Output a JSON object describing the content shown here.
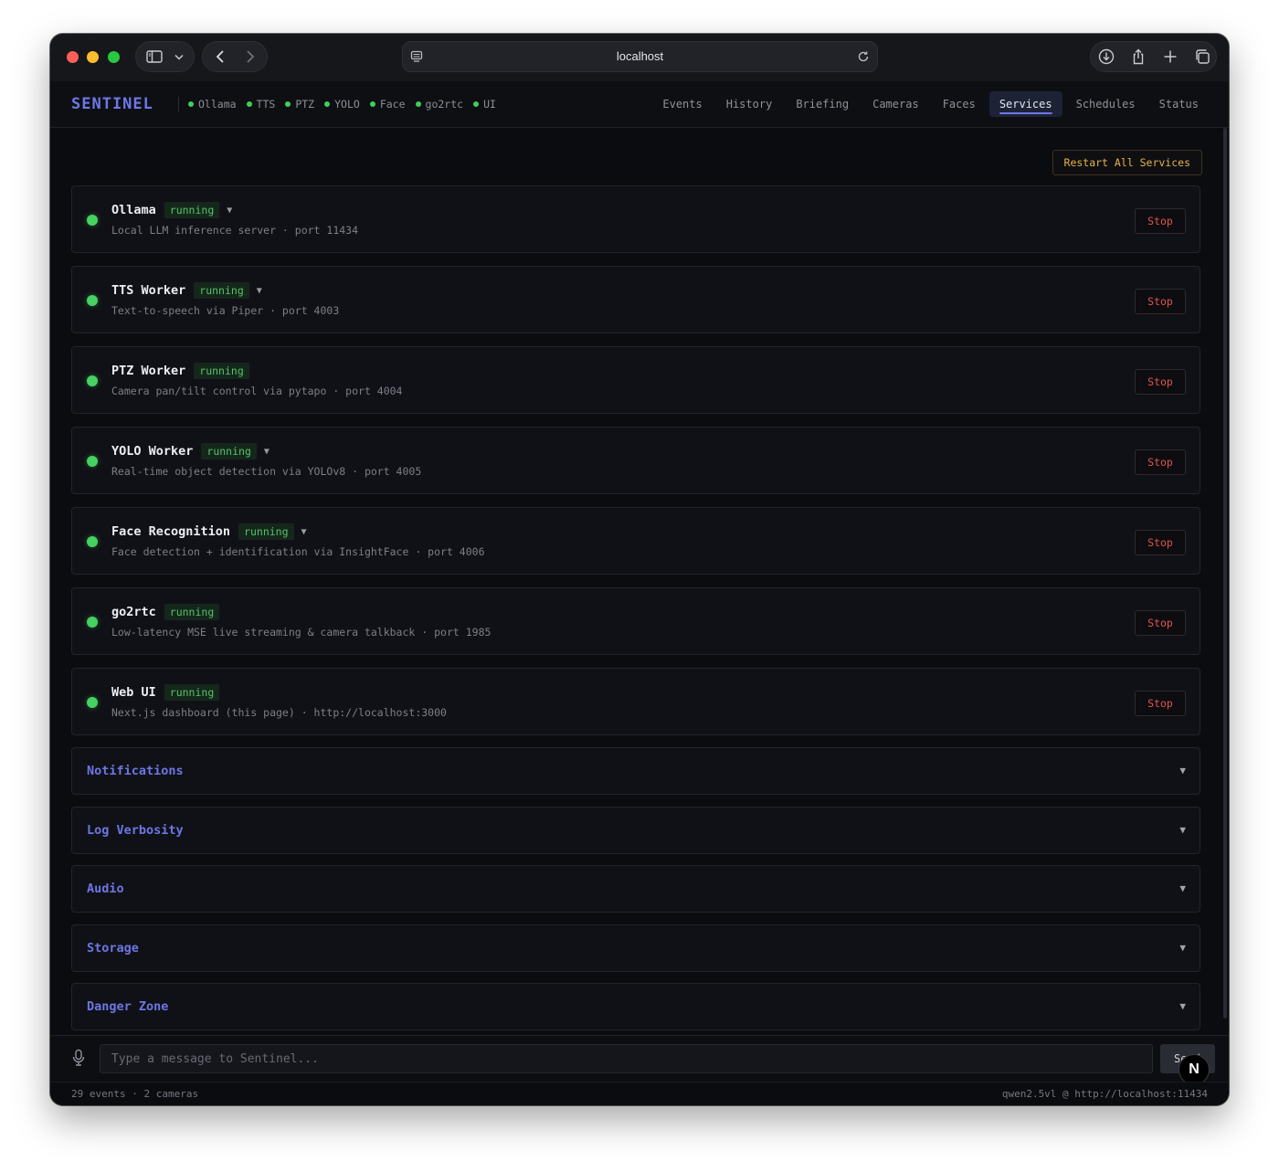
{
  "browser": {
    "url": "localhost"
  },
  "app": {
    "brand": "SENTINEL",
    "service_status": [
      {
        "label": "Ollama",
        "status_color": "#3fcf5a"
      },
      {
        "label": "TTS",
        "status_color": "#3fcf5a"
      },
      {
        "label": "PTZ",
        "status_color": "#3fcf5a"
      },
      {
        "label": "YOLO",
        "status_color": "#3fcf5a"
      },
      {
        "label": "Face",
        "status_color": "#3fcf5a"
      },
      {
        "label": "go2rtc",
        "status_color": "#3fcf5a"
      },
      {
        "label": "UI",
        "status_color": "#3fcf5a"
      }
    ],
    "tabs": [
      "Events",
      "History",
      "Briefing",
      "Cameras",
      "Faces",
      "Services",
      "Schedules",
      "Status"
    ],
    "active_tab": "Services"
  },
  "main": {
    "restart_all_label": "Restart All Services",
    "services": [
      {
        "name": "Ollama",
        "status": "running",
        "expandable": true,
        "description": "Local LLM inference server · port 11434",
        "action": "Stop"
      },
      {
        "name": "TTS Worker",
        "status": "running",
        "expandable": true,
        "description": "Text-to-speech via Piper · port 4003",
        "action": "Stop"
      },
      {
        "name": "PTZ Worker",
        "status": "running",
        "expandable": false,
        "description": "Camera pan/tilt control via pytapo · port 4004",
        "action": "Stop"
      },
      {
        "name": "YOLO Worker",
        "status": "running",
        "expandable": true,
        "description": "Real-time object detection via YOLOv8 · port 4005",
        "action": "Stop"
      },
      {
        "name": "Face Recognition",
        "status": "running",
        "expandable": true,
        "description": "Face detection + identification via InsightFace · port 4006",
        "action": "Stop"
      },
      {
        "name": "go2rtc",
        "status": "running",
        "expandable": false,
        "description": "Low-latency MSE live streaming & camera talkback · port 1985",
        "action": "Stop"
      },
      {
        "name": "Web UI",
        "status": "running",
        "expandable": false,
        "description": "Next.js dashboard (this page) · http://localhost:3000",
        "action": "Stop"
      }
    ],
    "sections": [
      "Notifications",
      "Log Verbosity",
      "Audio",
      "Storage",
      "Danger Zone"
    ],
    "colors": {
      "accent": "#6e78e8",
      "running": "#46d160",
      "stop": "#e0544b",
      "restart": "#e3b34e"
    }
  },
  "chat": {
    "placeholder": "Type a message to Sentinel...",
    "send_label": "Send",
    "avatar_letter": "N"
  },
  "footer": {
    "left": "29 events · 2 cameras",
    "right": "qwen2.5vl @ http://localhost:11434"
  }
}
